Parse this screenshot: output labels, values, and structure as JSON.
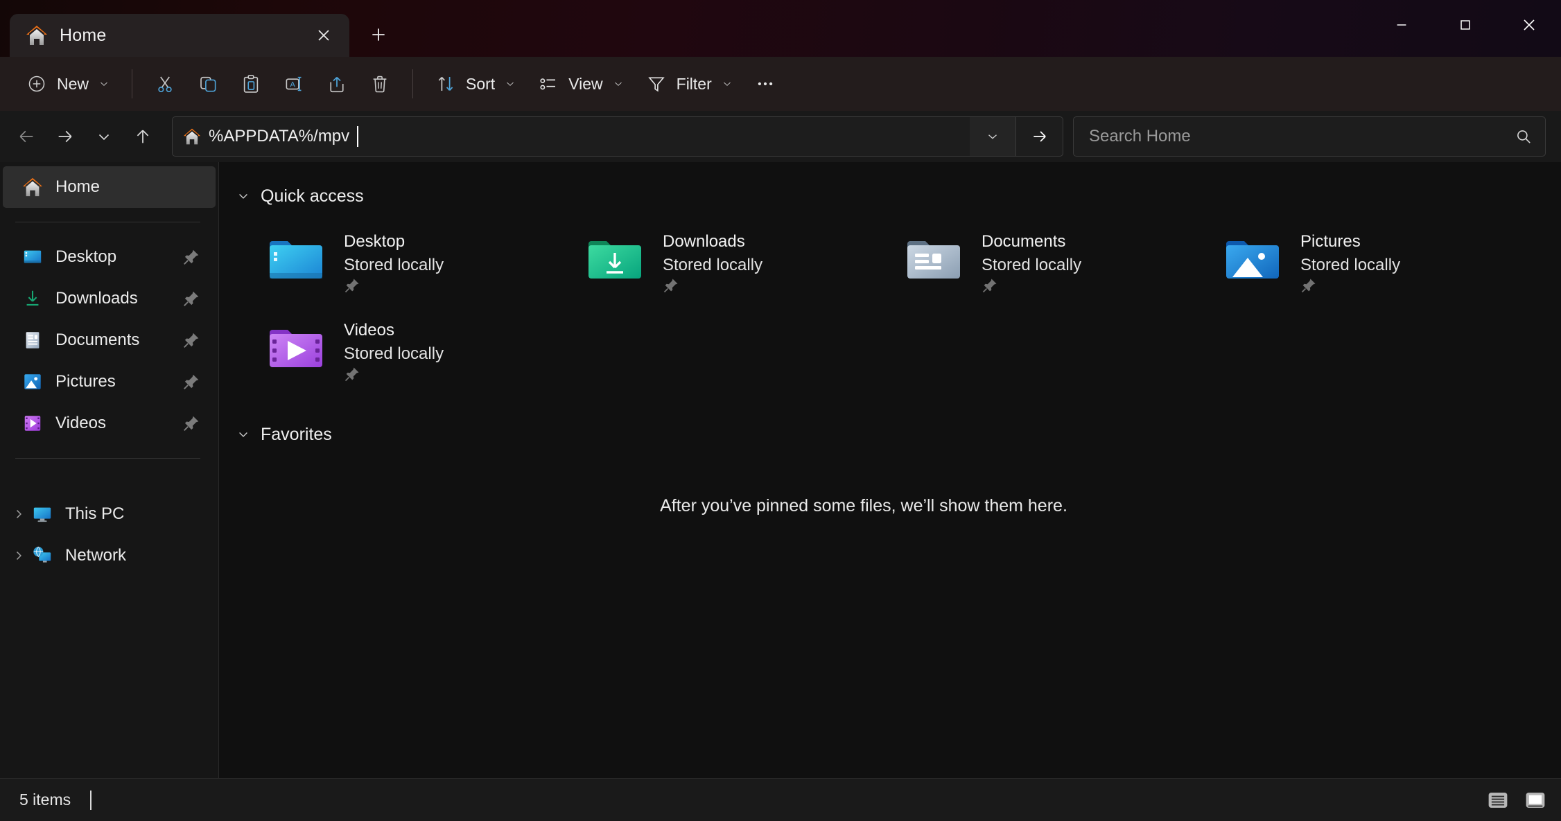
{
  "window": {
    "title": "Home",
    "controls": {
      "minimize": "Minimize",
      "maximize": "Maximize",
      "close": "Close"
    }
  },
  "tabs": [
    {
      "label": "Home",
      "icon": "home-icon",
      "active": true
    }
  ],
  "new_tab_label": "New tab",
  "toolbar": {
    "new_label": "New",
    "cut_label": "Cut",
    "copy_label": "Copy",
    "paste_label": "Paste",
    "rename_label": "Rename",
    "share_label": "Share",
    "delete_label": "Delete",
    "sort_label": "Sort",
    "view_label": "View",
    "filter_label": "Filter",
    "more_label": "See more"
  },
  "navigation": {
    "back_label": "Back",
    "forward_label": "Forward",
    "recent_label": "Recent locations",
    "up_label": "Up to Desktop",
    "address_value": "%APPDATA%/mpv",
    "address_icon": "home-icon",
    "address_dropdown_label": "Previous locations",
    "go_label": "Go to %APPDATA%/mpv",
    "search_placeholder": "Search Home"
  },
  "sidebar": {
    "items": [
      {
        "label": "Home",
        "icon": "home-icon",
        "selected": true,
        "pinned": false,
        "expandable": false
      },
      {
        "label": "Desktop",
        "icon": "desktop-icon",
        "selected": false,
        "pinned": true,
        "expandable": false
      },
      {
        "label": "Downloads",
        "icon": "downloads-icon",
        "selected": false,
        "pinned": true,
        "expandable": false
      },
      {
        "label": "Documents",
        "icon": "documents-icon",
        "selected": false,
        "pinned": true,
        "expandable": false
      },
      {
        "label": "Pictures",
        "icon": "pictures-icon",
        "selected": false,
        "pinned": true,
        "expandable": false
      },
      {
        "label": "Videos",
        "icon": "videos-icon",
        "selected": false,
        "pinned": true,
        "expandable": false
      },
      {
        "label": "This PC",
        "icon": "this-pc-icon",
        "selected": false,
        "pinned": false,
        "expandable": true
      },
      {
        "label": "Network",
        "icon": "network-icon",
        "selected": false,
        "pinned": false,
        "expandable": true
      }
    ]
  },
  "content": {
    "quick_access": {
      "title": "Quick access",
      "expanded": true,
      "items": [
        {
          "name": "Desktop",
          "status": "Stored locally",
          "icon": "folder-desktop-icon",
          "pinned": true
        },
        {
          "name": "Downloads",
          "status": "Stored locally",
          "icon": "folder-downloads-icon",
          "pinned": true
        },
        {
          "name": "Documents",
          "status": "Stored locally",
          "icon": "folder-documents-icon",
          "pinned": true
        },
        {
          "name": "Pictures",
          "status": "Stored locally",
          "icon": "folder-pictures-icon",
          "pinned": true
        },
        {
          "name": "Videos",
          "status": "Stored locally",
          "icon": "folder-videos-icon",
          "pinned": true
        }
      ]
    },
    "favorites": {
      "title": "Favorites",
      "expanded": true,
      "empty_message": "After you’ve pinned some files, we’ll show them here."
    }
  },
  "statusbar": {
    "item_count": "5 items",
    "details_view_label": "Details view",
    "large_icons_view_label": "Large icons view"
  },
  "colors": {
    "titlebar_tint": "#1d070f",
    "toolbar_bg": "#231c1c",
    "content_bg": "#101010",
    "sidebar_bg": "#161616",
    "accent_orange": "#ef7216",
    "accent_blue": "#3aa0e0",
    "accent_green": "#17a673",
    "accent_purple": "#b15fe0"
  }
}
